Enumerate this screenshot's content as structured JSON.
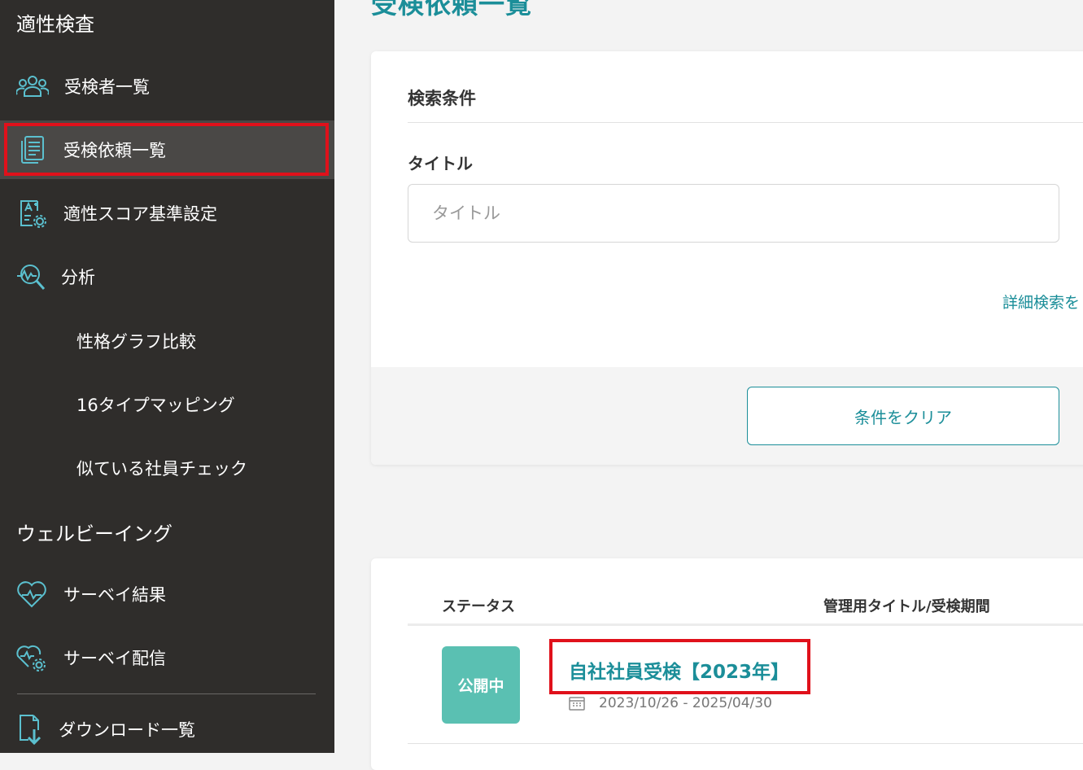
{
  "sidebar": {
    "section_aptitude": "適性検査",
    "items": [
      {
        "label": "受検者一覧",
        "icon": "people-icon"
      },
      {
        "label": "受検依頼一覧",
        "icon": "document-list-icon"
      },
      {
        "label": "適性スコア基準設定",
        "icon": "score-settings-icon"
      },
      {
        "label": "分析",
        "icon": "analysis-magnifier-icon"
      }
    ],
    "analysis_sub": [
      "性格グラフ比較",
      "16タイプマッピング",
      "似ている社員チェック"
    ],
    "section_wellbeing": "ウェルビーイング",
    "wellbeing_items": [
      {
        "label": "サーベイ結果",
        "icon": "heart-pulse-icon"
      },
      {
        "label": "サーベイ配信",
        "icon": "heart-settings-icon"
      }
    ],
    "download_item": {
      "label": "ダウンロード一覧",
      "icon": "download-document-icon"
    }
  },
  "main": {
    "page_title": "受検依頼一覧",
    "search": {
      "heading": "検索条件",
      "title_label": "タイトル",
      "title_placeholder": "タイトル",
      "title_value": "",
      "detail_link": "詳細検索を",
      "clear_button": "条件をクリア"
    },
    "results": {
      "col_status": "ステータス",
      "col_title": "管理用タイトル/受検期間",
      "rows": [
        {
          "status": "公開中",
          "title": "自社社員受検【2023年】",
          "period": "2023/10/26 - 2025/04/30"
        }
      ]
    }
  },
  "colors": {
    "accent": "#1b8e99",
    "sidebar_bg": "#2f2d2b",
    "status_public": "#5ac0b2",
    "highlight": "#e0111b"
  }
}
